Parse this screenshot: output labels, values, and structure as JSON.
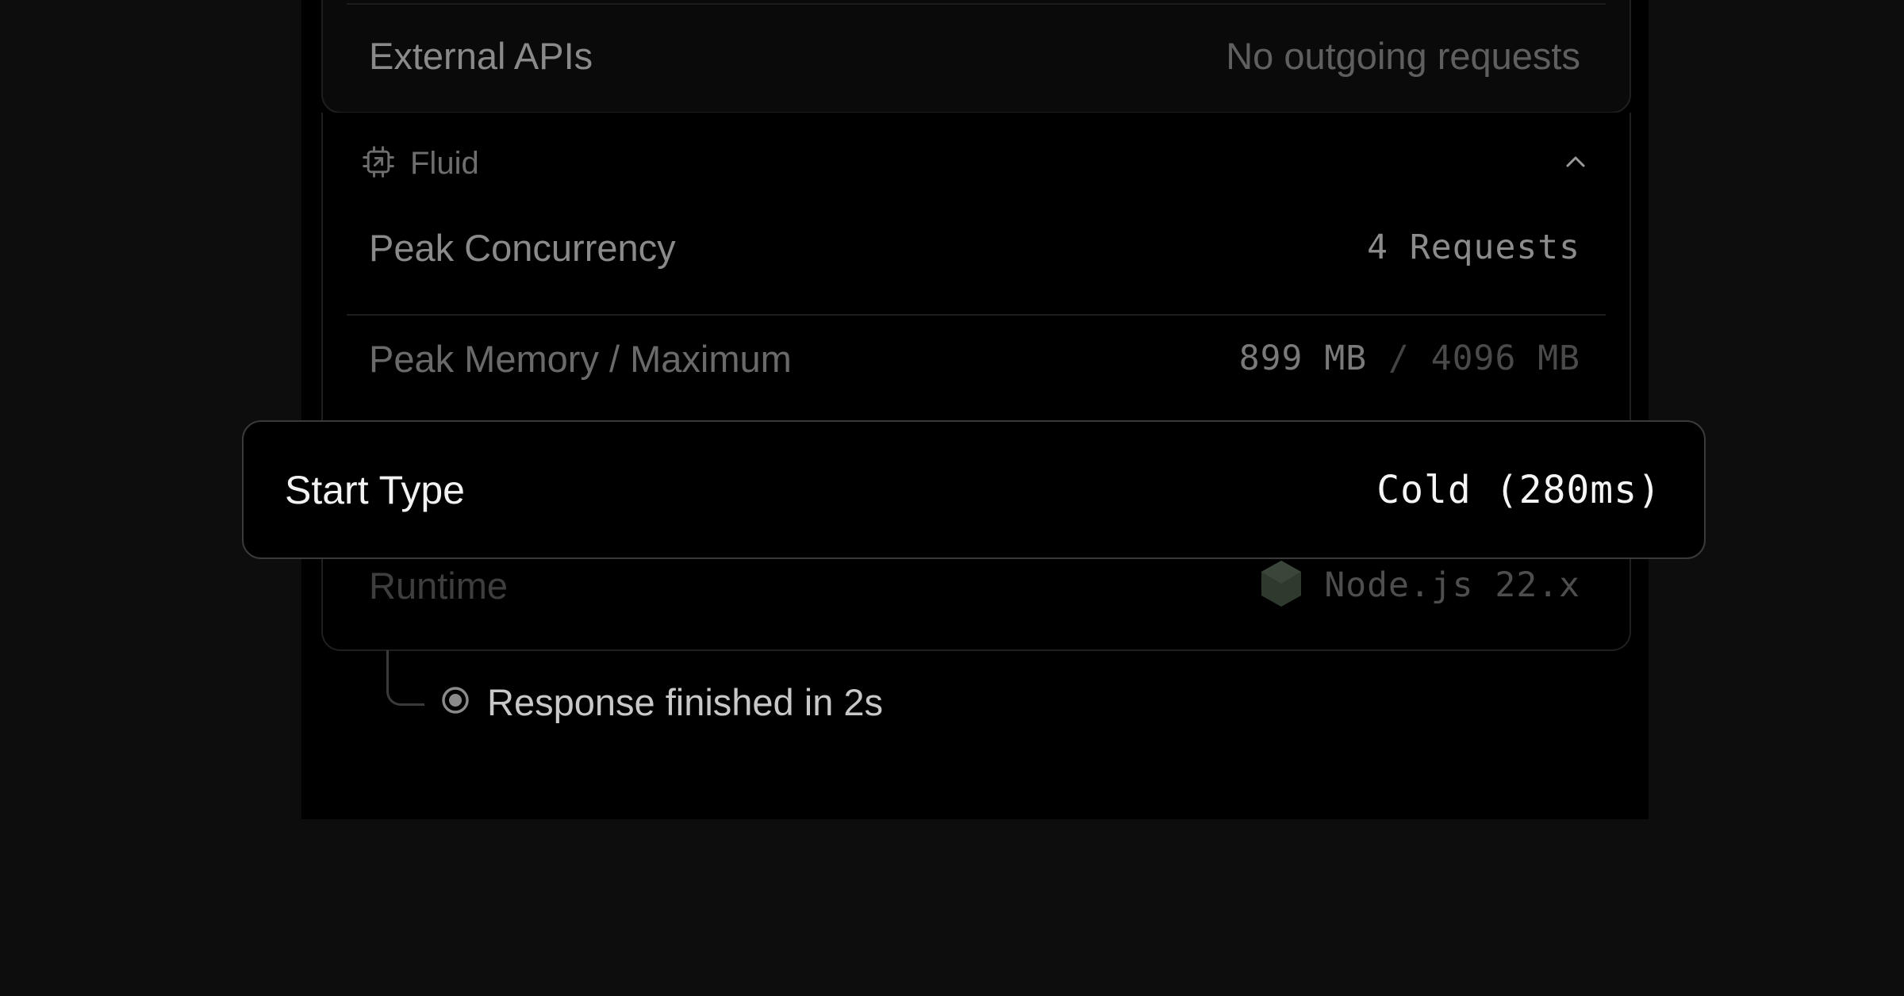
{
  "external_apis": {
    "label": "External APIs",
    "value": "No outgoing requests"
  },
  "fluid": {
    "title": "Fluid",
    "icon": "cpu-icon",
    "collapse_icon": "chevron-up-icon",
    "peak_concurrency": {
      "label": "Peak Concurrency",
      "value": "4 Requests"
    },
    "peak_memory": {
      "label": "Peak Memory / Maximum",
      "used": "899 MB",
      "separator": "/",
      "max": "4096 MB"
    },
    "start_type": {
      "label": "Start Type",
      "value": "Cold (280ms)"
    },
    "runtime": {
      "label": "Runtime",
      "icon": "nodejs-icon",
      "value": "Node.js 22.x"
    }
  },
  "response": {
    "icon": "radio-dot-icon",
    "text": "Response finished in 2s"
  },
  "colors": {
    "background": "#0d0d0d",
    "panel": "#000000",
    "border": "#1f1f1f",
    "highlight_border": "#3a3a3a"
  }
}
